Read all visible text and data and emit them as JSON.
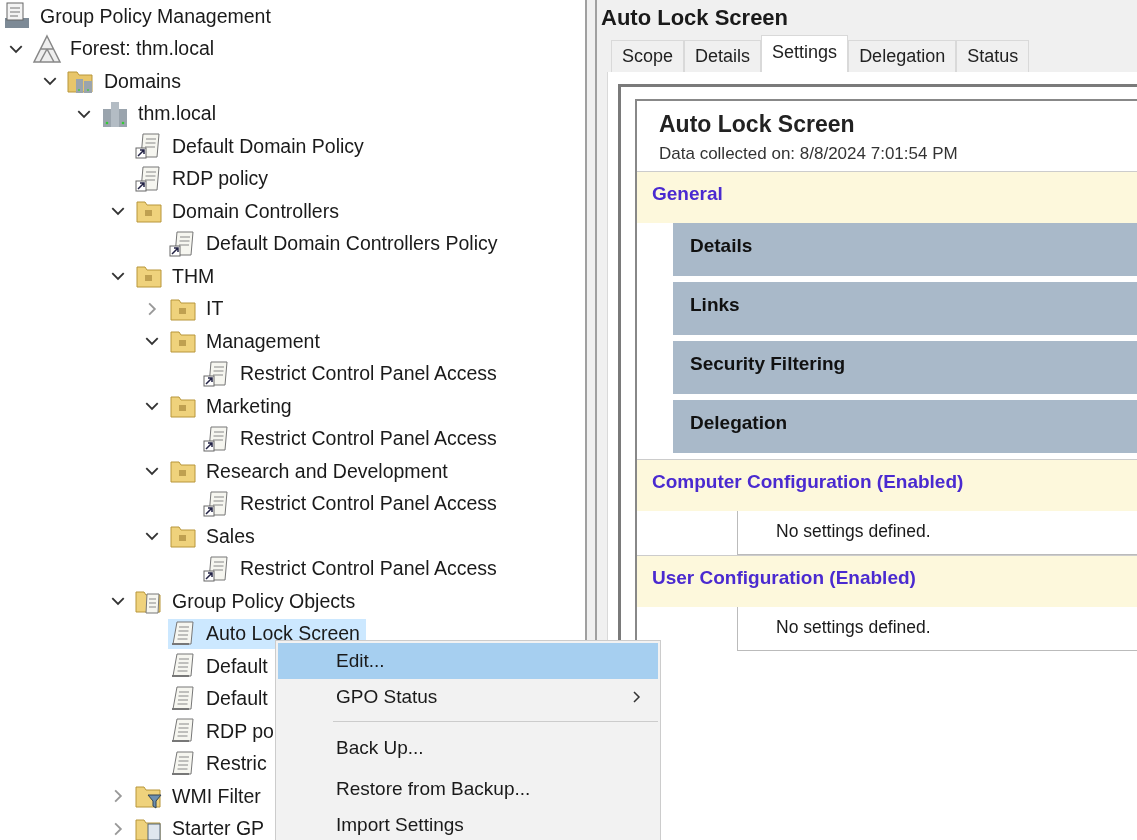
{
  "tree": [
    {
      "label": "Group Policy Management",
      "kind": "console",
      "selected": false,
      "children": [
        {
          "label": "Forest: thm.local",
          "kind": "forest",
          "expanded": true,
          "selected": false,
          "children": [
            {
              "label": "Domains",
              "kind": "domains",
              "expanded": true,
              "selected": false,
              "children": [
                {
                  "label": "thm.local",
                  "kind": "domain",
                  "expanded": true,
                  "selected": false,
                  "children": [
                    {
                      "label": "Default Domain Policy",
                      "kind": "link",
                      "selected": false
                    },
                    {
                      "label": "RDP policy",
                      "kind": "link",
                      "selected": false
                    },
                    {
                      "label": "Domain Controllers",
                      "kind": "ou",
                      "expanded": true,
                      "selected": false,
                      "children": [
                        {
                          "label": "Default Domain Controllers Policy",
                          "kind": "link",
                          "selected": false
                        }
                      ]
                    },
                    {
                      "label": "THM",
                      "kind": "ou",
                      "expanded": true,
                      "selected": false,
                      "children": [
                        {
                          "label": "IT",
                          "kind": "ou",
                          "expanded": false,
                          "selected": false
                        },
                        {
                          "label": "Management",
                          "kind": "ou",
                          "expanded": true,
                          "selected": false,
                          "children": [
                            {
                              "label": "Restrict Control Panel Access",
                              "kind": "link",
                              "selected": false
                            }
                          ]
                        },
                        {
                          "label": "Marketing",
                          "kind": "ou",
                          "expanded": true,
                          "selected": false,
                          "children": [
                            {
                              "label": "Restrict Control Panel Access",
                              "kind": "link",
                              "selected": false
                            }
                          ]
                        },
                        {
                          "label": "Research and Development",
                          "kind": "ou",
                          "expanded": true,
                          "selected": false,
                          "children": [
                            {
                              "label": "Restrict Control Panel Access",
                              "kind": "link",
                              "selected": false
                            }
                          ]
                        },
                        {
                          "label": "Sales",
                          "kind": "ou",
                          "expanded": true,
                          "selected": false,
                          "children": [
                            {
                              "label": "Restrict Control Panel Access",
                              "kind": "link",
                              "selected": false
                            }
                          ]
                        }
                      ]
                    },
                    {
                      "label": "Group Policy Objects",
                      "kind": "gpo-folder",
                      "expanded": true,
                      "selected": false,
                      "children": [
                        {
                          "label": "Auto Lock Screen",
                          "kind": "gpo",
                          "selected": true
                        },
                        {
                          "label": "Default",
                          "kind": "gpo",
                          "selected": false
                        },
                        {
                          "label": "Default",
                          "kind": "gpo",
                          "selected": false
                        },
                        {
                          "label": "RDP po",
                          "kind": "gpo",
                          "selected": false
                        },
                        {
                          "label": "Restric",
                          "kind": "gpo",
                          "selected": false
                        }
                      ]
                    },
                    {
                      "label": "WMI Filter",
                      "kind": "wmi",
                      "expanded": false,
                      "selected": false
                    },
                    {
                      "label": "Starter GP",
                      "kind": "starter",
                      "expanded": false,
                      "selected": false
                    }
                  ]
                }
              ]
            }
          ]
        }
      ]
    }
  ],
  "details": {
    "title": "Auto Lock Screen",
    "tabs": [
      {
        "label": "Scope",
        "selected": false
      },
      {
        "label": "Details",
        "selected": false
      },
      {
        "label": "Settings",
        "selected": true
      },
      {
        "label": "Delegation",
        "selected": false
      },
      {
        "label": "Status",
        "selected": false
      }
    ],
    "report": {
      "title": "Auto Lock Screen",
      "collected": "Data collected on: 8/8/2024 7:01:54 PM",
      "sections": [
        {
          "kind": "group",
          "heading": "General",
          "subsections": [
            "Details",
            "Links",
            "Security Filtering",
            "Delegation"
          ]
        },
        {
          "kind": "config",
          "heading": "Computer Configuration (Enabled)",
          "note": "No settings defined."
        },
        {
          "kind": "config",
          "heading": "User Configuration (Enabled)",
          "note": "No settings defined."
        }
      ]
    }
  },
  "context_menu": {
    "items": [
      {
        "label": "Edit...",
        "selected": true,
        "submenu": false,
        "separator_before": false
      },
      {
        "label": "GPO Status",
        "selected": false,
        "submenu": true,
        "separator_before": false
      },
      {
        "label": "Back Up...",
        "selected": false,
        "submenu": false,
        "separator_before": true
      },
      {
        "label": "Restore from Backup...",
        "selected": false,
        "submenu": false,
        "separator_before": false
      },
      {
        "label": "Import Settings",
        "selected": false,
        "submenu": false,
        "separator_before": false
      }
    ]
  }
}
